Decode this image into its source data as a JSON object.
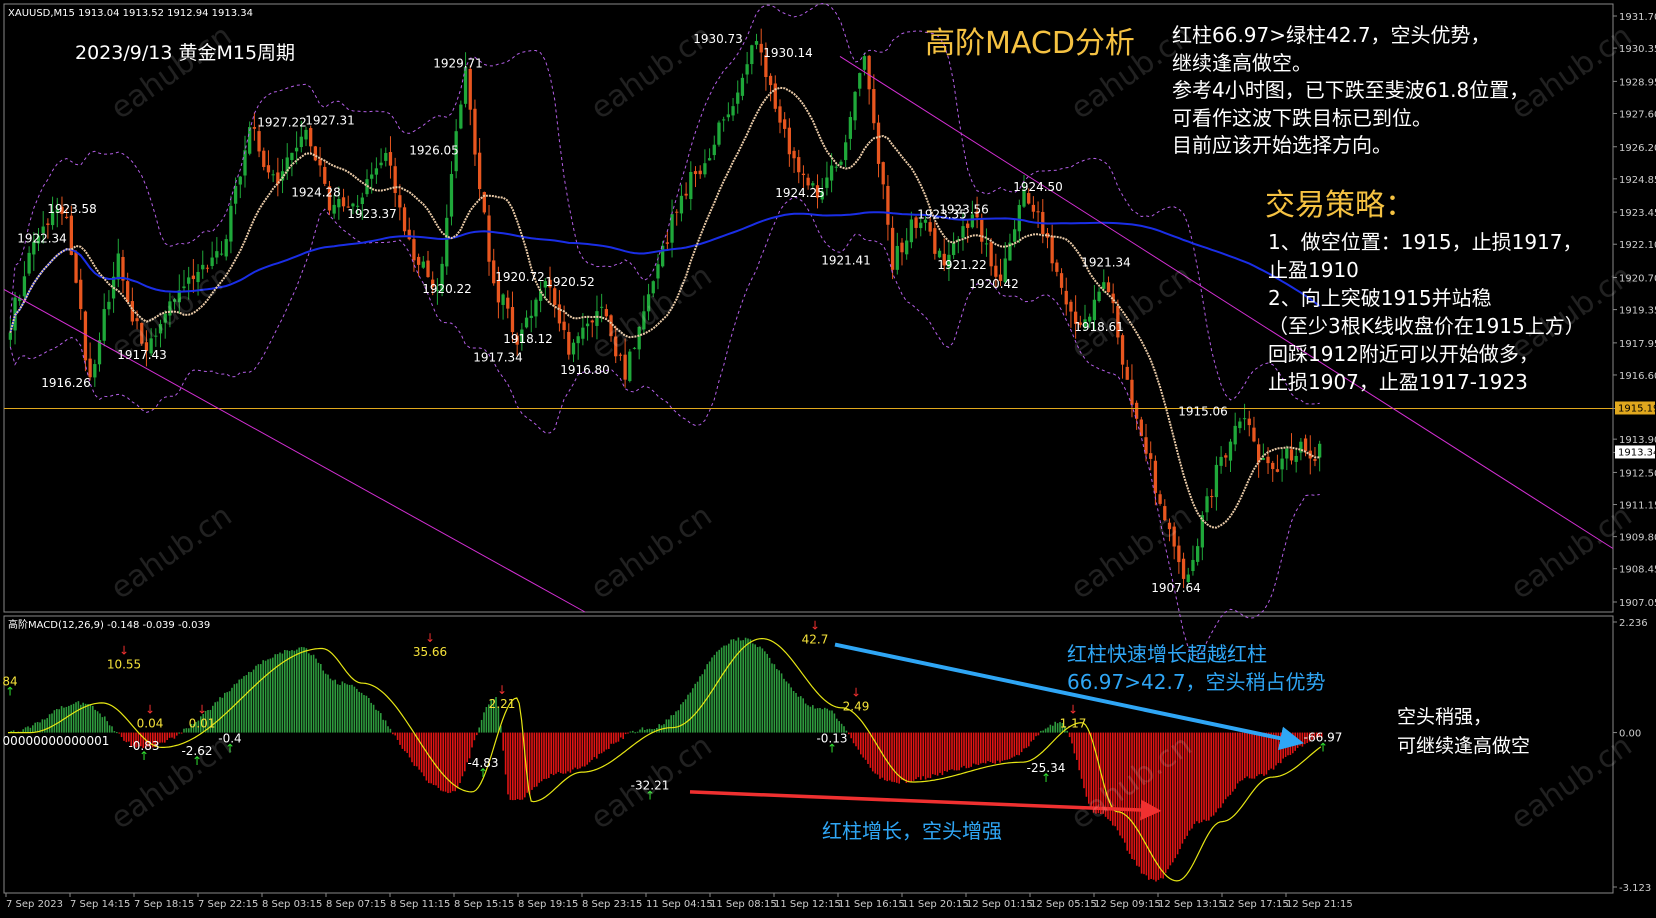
{
  "symbol_header": "XAUUSD,M15  1913.04 1913.52 1912.94 1913.34",
  "macd_header": "高阶MACD(12,26,9) -0.148 -0.039 -0.039",
  "chart_title": "高阶MACD分析",
  "period_label": "2023/9/13 黄金M15周期",
  "analysis_lines": [
    "红柱66.97>绿柱42.7，空头优势，",
    "继续逢高做空。",
    "参考4小时图，已下跌至斐波61.8位置，",
    "可看作这波下跌目标已到位。",
    "目前应该开始选择方向。"
  ],
  "strategy_title": "交易策略：",
  "strategy_lines": [
    "1、做空位置：1915，止损1917，",
    "    止盈1910",
    "2、向上突破1915并站稳",
    "  （至少3根K线收盘价在1915上方）",
    "   回踩1912附近可以开始做多，",
    "   止损1907，止盈1917-1923"
  ],
  "macd_annotations": {
    "red_beats_green": [
      "红柱快速增长超越红柱",
      "66.97>42.7，空头稍占优势"
    ],
    "red_growth": "红柱增长，空头增强",
    "conclusion": [
      "空头稍强，",
      "可继续逢高做空"
    ]
  },
  "watermark": "eahub.cn",
  "colors": {
    "bull_candle": "#1fa83a",
    "bear_candle": "#e8561f",
    "ma_blue": "#1a2ee6",
    "ma_tan": "#e8c9a6",
    "bollinger": "#b35ee6",
    "trendline": "#d22fd2",
    "hline": "#e0a81e",
    "macd_green": "#2e9b3e",
    "macd_red": "#e01414",
    "signal": "#e6e614",
    "label_yellow": "#f5e23a",
    "text_blue": "#2fa6f5"
  },
  "chart_data": [
    {
      "type": "candlestick",
      "name": "XAUUSD M15",
      "x_ticks": [
        "7 Sep 2023",
        "7 Sep 14:15",
        "7 Sep 18:15",
        "7 Sep 22:15",
        "8 Sep 03:15",
        "8 Sep 07:15",
        "8 Sep 11:15",
        "8 Sep 15:15",
        "8 Sep 19:15",
        "8 Sep 23:15",
        "11 Sep 04:15",
        "11 Sep 08:15",
        "11 Sep 12:15",
        "11 Sep 16:15",
        "11 Sep 20:15",
        "12 Sep 01:15",
        "12 Sep 05:15",
        "12 Sep 09:15",
        "12 Sep 13:15",
        "12 Sep 17:15",
        "12 Sep 21:15"
      ],
      "y_ticks": [
        1931.7,
        1930.35,
        1928.95,
        1927.6,
        1926.2,
        1924.85,
        1923.45,
        1922.1,
        1920.7,
        1919.35,
        1917.95,
        1916.6,
        1915.19,
        1913.9,
        1913.34,
        1912.5,
        1911.15,
        1909.8,
        1908.45,
        1907.05
      ],
      "ylim": [
        1907.05,
        1931.7
      ],
      "current_price": 1913.34,
      "horizontal_line": 1915.19,
      "path": [
        1918.8,
        1922.34,
        1923.58,
        1916.26,
        1921.5,
        1917.43,
        1919.8,
        1920.5,
        1922.0,
        1927.22,
        1924.28,
        1927.31,
        1923.37,
        1924.0,
        1926.05,
        1922.0,
        1920.22,
        1929.71,
        1920.72,
        1918.12,
        1920.52,
        1917.34,
        1919.8,
        1916.8,
        1920.0,
        1924.0,
        1925.5,
        1928.0,
        1930.73,
        1926.5,
        1924.25,
        1925.5,
        1930.14,
        1921.41,
        1923.35,
        1921.22,
        1923.56,
        1920.42,
        1924.5,
        1921.34,
        1918.61,
        1920.7,
        1915.5,
        1911.5,
        1907.64,
        1912.0,
        1915.06,
        1912.5,
        1913.5,
        1913.34
      ],
      "price_labels": [
        {
          "text": "1923.58",
          "value": 1923.58
        },
        {
          "text": "1922.34",
          "value": 1922.34
        },
        {
          "text": "1916.26",
          "value": 1916.26
        },
        {
          "text": "1917.43",
          "value": 1917.43
        },
        {
          "text": "1927.22",
          "value": 1927.22
        },
        {
          "text": "1927.31",
          "value": 1927.31
        },
        {
          "text": "1924.28",
          "value": 1924.28
        },
        {
          "text": "1923.37",
          "value": 1923.37
        },
        {
          "text": "1926.05",
          "value": 1926.05
        },
        {
          "text": "1929.71",
          "value": 1929.71
        },
        {
          "text": "1920.22",
          "value": 1920.22
        },
        {
          "text": "1920.72",
          "value": 1920.72
        },
        {
          "text": "1920.52",
          "value": 1920.52
        },
        {
          "text": "1918.12",
          "value": 1918.12
        },
        {
          "text": "1917.34",
          "value": 1917.34
        },
        {
          "text": "1916.80",
          "value": 1916.8
        },
        {
          "text": "1930.73",
          "value": 1930.73
        },
        {
          "text": "1930.14",
          "value": 1930.14
        },
        {
          "text": "1924.25",
          "value": 1924.25
        },
        {
          "text": "1921.41",
          "value": 1921.41
        },
        {
          "text": "1923.35",
          "value": 1923.35
        },
        {
          "text": "1923.56",
          "value": 1923.56
        },
        {
          "text": "1921.22",
          "value": 1921.22
        },
        {
          "text": "1920.42",
          "value": 1920.42
        },
        {
          "text": "1924.50",
          "value": 1924.5
        },
        {
          "text": "1921.34",
          "value": 1921.34
        },
        {
          "text": "1918.61",
          "value": 1918.61
        },
        {
          "text": "1915.06",
          "value": 1915.06
        },
        {
          "text": "1907.64",
          "value": 1907.64
        }
      ]
    },
    {
      "type": "bar",
      "name": "高阶MACD(12,26,9)",
      "values_readout": [
        -0.148,
        -0.039,
        -0.039
      ],
      "y_ticks": [
        2.236,
        0.0,
        -3.123
      ],
      "ylim": [
        -3.123,
        2.236
      ],
      "signal_labels": [
        "84",
        "10.55",
        "0.04",
        "-0.83",
        "0.01",
        "-2.62",
        "-0.4",
        "35.66",
        "-4.83",
        "2.21",
        "-32.21",
        "42.7",
        "-0.13",
        "2.49",
        "-25.34",
        "1.17",
        "-66.97",
        "00000000000001"
      ],
      "peak_compare": {
        "red": 66.97,
        "green": 42.7
      }
    }
  ]
}
